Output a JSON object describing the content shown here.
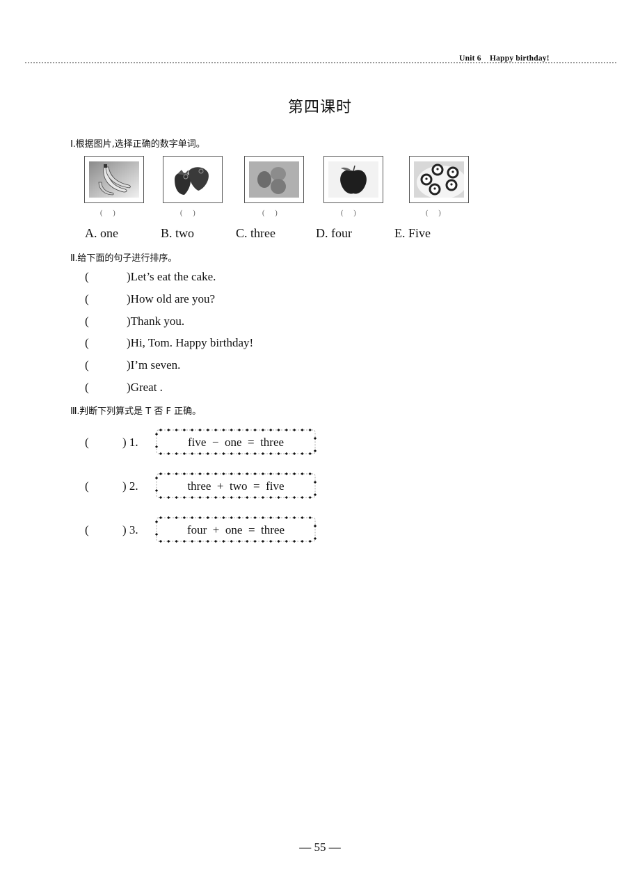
{
  "header": {
    "unit": "Unit 6",
    "title": "Happy birthday!"
  },
  "lesson_title": "第四课时",
  "section1": {
    "number": "Ⅰ.",
    "instruction": "根据图片,选择正确的数字单词。",
    "pictures": [
      {
        "subject": "bananas",
        "icon": "banana-icon",
        "answer_blank": "(      )"
      },
      {
        "subject": "strawberries",
        "icon": "strawberry-icon",
        "answer_blank": "(      )"
      },
      {
        "subject": "eggs",
        "icon": "egg-icon",
        "answer_blank": "(      )"
      },
      {
        "subject": "apple",
        "icon": "apple-icon",
        "answer_blank": "(      )"
      },
      {
        "subject": "cakes",
        "icon": "cake-icon",
        "answer_blank": "(      )"
      }
    ],
    "options": [
      "A. one",
      "B. two",
      "C. three",
      "D. four",
      "E. Five"
    ]
  },
  "section2": {
    "number": "Ⅱ.",
    "instruction": "给下面的句子进行排序。",
    "blank_open": "(",
    "blank_close": ")",
    "sentences": [
      "Let’s eat the cake.",
      "How old are you?",
      "Thank you.",
      "Hi, Tom. Happy birthday!",
      "I’m seven.",
      "Great ."
    ]
  },
  "section3": {
    "number": "Ⅲ.",
    "instruction": "判断下列算式是 T 否 F 正确。",
    "blank_open": "(",
    "items": [
      {
        "label": ") 1.",
        "equation": "five  −  one  =  three"
      },
      {
        "label": ") 2.",
        "equation": "three  +  two  =  five"
      },
      {
        "label": ") 3.",
        "equation": "four  +  one  =  three"
      }
    ]
  },
  "footer": {
    "page_number": "— 55 —"
  }
}
